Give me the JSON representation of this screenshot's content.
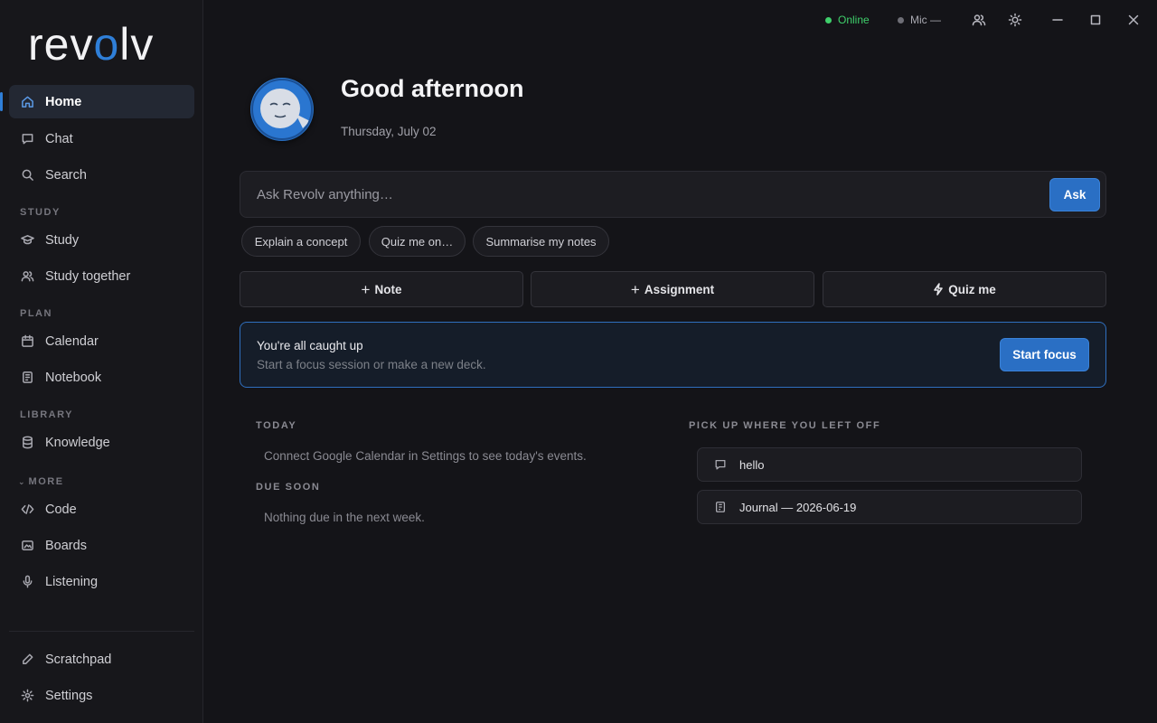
{
  "brand": {
    "logo_pre": "rev",
    "logo_o": "o",
    "logo_post": "lv"
  },
  "sidebar": {
    "items": [
      {
        "label": "Home",
        "icon": "home-icon"
      },
      {
        "label": "Chat",
        "icon": "chat-icon"
      },
      {
        "label": "Search",
        "icon": "search-icon"
      }
    ],
    "study_label": "STUDY",
    "study_items": [
      {
        "label": "Study",
        "icon": "graduation-cap-icon"
      },
      {
        "label": "Study together",
        "icon": "users-icon"
      }
    ],
    "plan_label": "PLAN",
    "plan_items": [
      {
        "label": "Calendar",
        "icon": "calendar-icon"
      },
      {
        "label": "Notebook",
        "icon": "notebook-icon"
      }
    ],
    "library_label": "LIBRARY",
    "library_items": [
      {
        "label": "Knowledge",
        "icon": "database-icon"
      }
    ],
    "more_label": "MORE",
    "more_items": [
      {
        "label": "Code",
        "icon": "code-icon"
      },
      {
        "label": "Boards",
        "icon": "board-icon"
      },
      {
        "label": "Listening",
        "icon": "microphone-icon"
      }
    ],
    "footer_items": [
      {
        "label": "Scratchpad",
        "icon": "pencil-icon"
      },
      {
        "label": "Settings",
        "icon": "gear-icon"
      }
    ]
  },
  "topbar": {
    "online_label": "Online",
    "mic_label": "Mic —",
    "online_color": "#3fcf6b"
  },
  "main": {
    "greeting": "Good afternoon",
    "date": "Thursday, July 02",
    "ask": {
      "placeholder": "Ask Revolv anything…",
      "button": "Ask"
    },
    "chips": [
      "Explain a concept",
      "Quiz me on…",
      "Summarise my notes"
    ],
    "actions": {
      "note": "Note",
      "assignment": "Assignment",
      "quiz": "Quiz me"
    },
    "banner": {
      "title": "You're all caught up",
      "subtitle": "Start a focus session or make a new deck.",
      "button": "Start focus"
    },
    "today": {
      "label": "TODAY",
      "text": "Connect Google Calendar in Settings to see today's events."
    },
    "due": {
      "label": "DUE SOON",
      "text": "Nothing due in the next week."
    },
    "recent": {
      "label": "PICK UP WHERE YOU LEFT OFF",
      "items": [
        {
          "title": "hello",
          "icon": "chat-icon"
        },
        {
          "title": "Journal — 2026-06-19",
          "icon": "notebook-icon"
        }
      ]
    }
  },
  "colors": {
    "accent": "#2f7fd8",
    "background": "#141418",
    "sidebar": "#17171b"
  }
}
